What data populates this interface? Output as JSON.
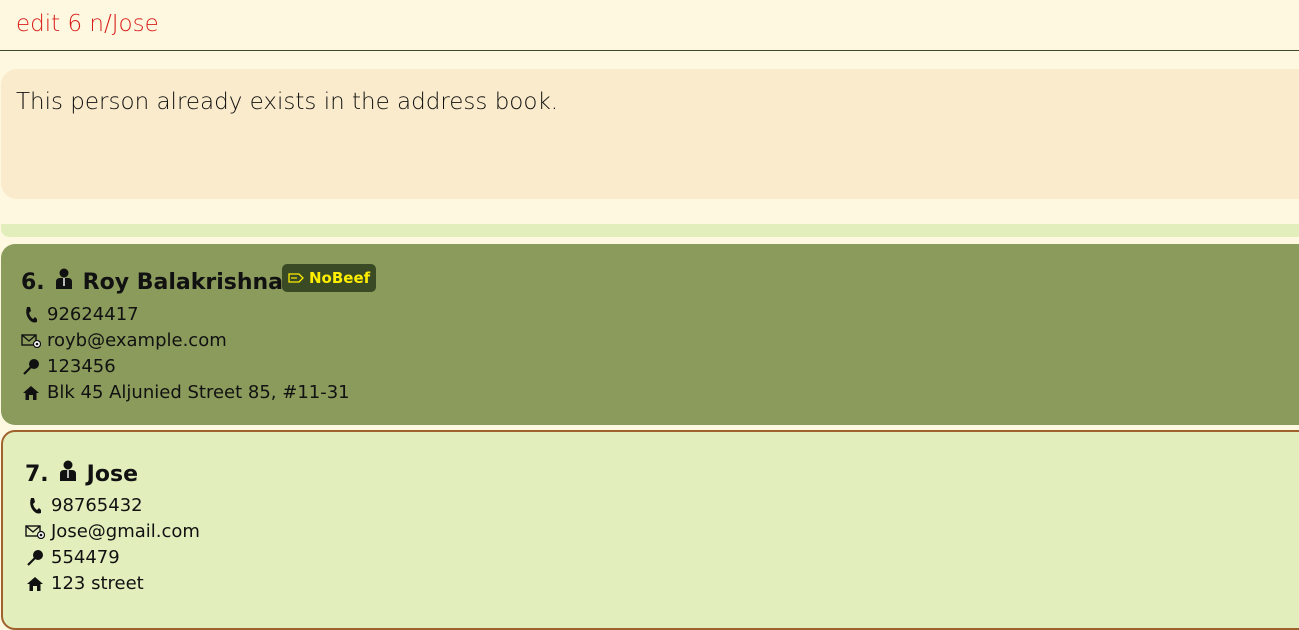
{
  "command_box": {
    "value": "edit 6 n/Jose"
  },
  "result_display": {
    "message": "This person already exists in the address book."
  },
  "colors": {
    "command_text": "#d8201b",
    "selected_card": "#8a9b5c",
    "card": "#e2efbd",
    "tag_bg": "#3a4a24",
    "tag_text": "#ffee00"
  },
  "persons": [
    {
      "index": "6.",
      "name": "Roy Balakrishnan",
      "tag": "NoBeef",
      "phone": "92624417",
      "email": "royb@example.com",
      "postal": "123456",
      "address": "Blk 45 Aljunied Street 85, #11-31"
    },
    {
      "index": "7.",
      "name": "Jose",
      "phone": "98765432",
      "email": "Jose@gmail.com",
      "postal": "554479",
      "address": "123 street"
    }
  ],
  "icons": [
    "person-icon",
    "tag-icon",
    "phone-icon",
    "email-icon",
    "pin-icon",
    "home-icon"
  ]
}
